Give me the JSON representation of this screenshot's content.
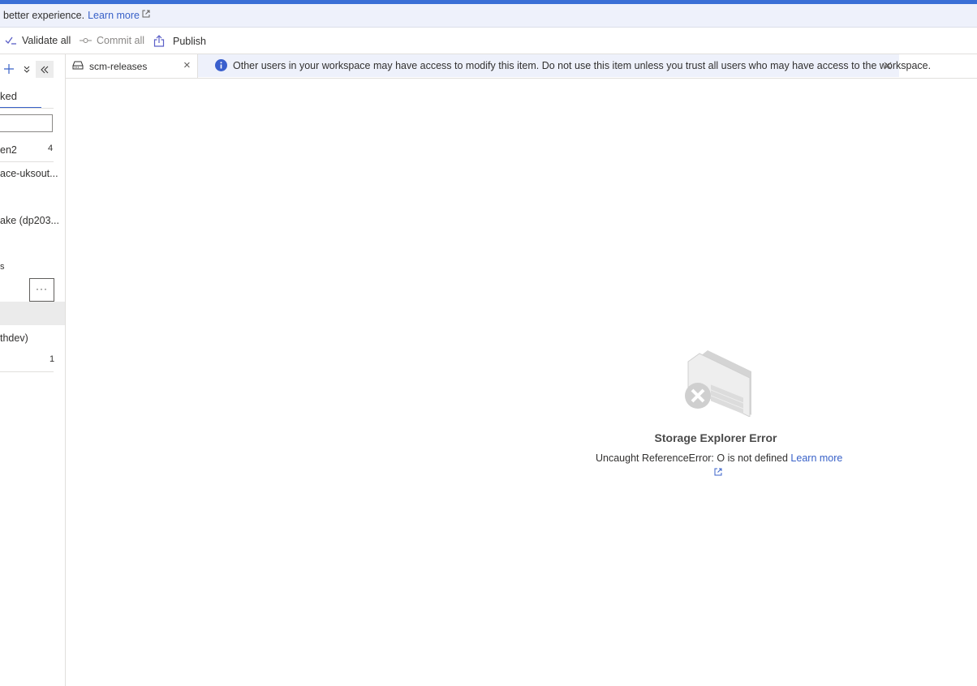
{
  "notice": {
    "text": "better experience.",
    "link": "Learn more"
  },
  "toolbar": {
    "validate_all": "Validate all",
    "commit_all": "Commit all",
    "publish": "Publish"
  },
  "left_panel": {
    "tab_label": "ked",
    "items": [
      {
        "label": "en2",
        "count": "4"
      },
      {
        "label": "ace-uksout..."
      },
      {
        "label": "ake (dp203..."
      },
      {
        "label": "s"
      },
      {
        "label": "thdev)"
      },
      {
        "label": "",
        "count": "1"
      }
    ],
    "more_label": "···"
  },
  "tab": {
    "label": "scm-releases",
    "close": "×"
  },
  "banner": {
    "text": "Other users in your workspace may have access to modify this item. Do not use this item unless you trust all users who may have access to the workspace."
  },
  "error": {
    "title": "Storage Explorer Error",
    "message": "Uncaught ReferenceError: O is not defined",
    "link": "Learn more"
  },
  "colors": {
    "accent": "#3861c8",
    "top_bar": "#3a6fd6",
    "banner_bg": "#eef1fb",
    "info_icon": "#3a5fcd"
  }
}
